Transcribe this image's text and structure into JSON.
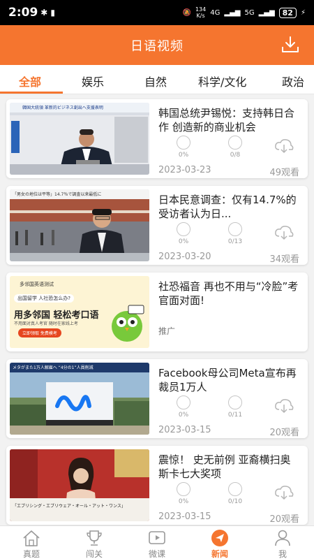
{
  "status_bar": {
    "time": "2:09",
    "speed_value": "134",
    "speed_unit": "K/s",
    "net1": "4G",
    "net2": "5G",
    "battery": "82"
  },
  "header": {
    "title": "日语视频",
    "download_icon": "download-icon"
  },
  "tabs": [
    {
      "label": "全部",
      "active": true
    },
    {
      "label": "娱乐"
    },
    {
      "label": "自然"
    },
    {
      "label": "科学/文化"
    },
    {
      "label": "政治"
    }
  ],
  "articles": [
    {
      "title": "韩国总统尹锡悦：支持韩日合作 创造新的商业机会",
      "stat1": "0%",
      "stat2": "0/8",
      "date": "2023-03-23",
      "views": "49观看",
      "thumb_caption": "韓国大統領 革新的ビジネス創出へ支援表明"
    },
    {
      "title": "日本民意调查：仅有14.7%的受访者认为日...",
      "stat1": "0%",
      "stat2": "0/13",
      "date": "2023-03-20",
      "views": "34观看",
      "thumb_caption": "「男女の地位は平等」14.7％で調査以来最低に"
    },
    {
      "title": "社恐福音 再也不用与“冷脸”考官面对面!",
      "ad": "推广",
      "ad_brand": "多邻国英语测试",
      "ad_q": "出国留学 人社恐怎么办?",
      "ad_headline": "用多邻国 轻松考口语",
      "ad_sub": "不用面对真人考官 随时在家线上考",
      "ad_cta": "立即领取 免费模考"
    },
    {
      "title": "Facebook母公司Meta宣布再裁员1万人",
      "stat1": "0%",
      "stat2": "0/11",
      "date": "2023-03-15",
      "views": "20观看",
      "thumb_caption": "メタがまた1万人解雇へ “4分の1”人員削減"
    },
    {
      "title": "震惊！ 史无前例 亚裔横扫奥斯卡七大奖项",
      "stat1": "0%",
      "stat2": "0/10",
      "date": "2023-03-15",
      "views": "20观看",
      "thumb_caption": "「エブリシング・エブリウェア・オール・アット・ワンス」"
    }
  ],
  "bottom_nav": [
    {
      "label": "真题",
      "icon": "home-icon"
    },
    {
      "label": "闯关",
      "icon": "trophy-icon"
    },
    {
      "label": "微课",
      "icon": "video-play-icon"
    },
    {
      "label": "新闻",
      "icon": "news-icon",
      "active": true
    },
    {
      "label": "我",
      "icon": "user-icon"
    }
  ],
  "colors": {
    "accent": "#f5752f",
    "muted": "#9a9a9a"
  }
}
